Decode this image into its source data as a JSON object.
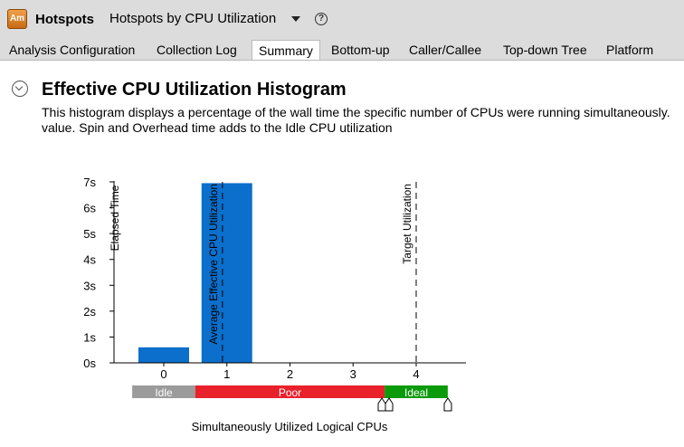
{
  "app": {
    "logo_text": "Am",
    "name": "Hotspots",
    "analysis_title": "Hotspots by CPU Utilization"
  },
  "tabs": [
    {
      "label": "Analysis Configuration"
    },
    {
      "label": "Collection Log"
    },
    {
      "label": "Summary",
      "active": true
    },
    {
      "label": "Bottom-up"
    },
    {
      "label": "Caller/Callee"
    },
    {
      "label": "Top-down Tree"
    },
    {
      "label": "Platform"
    }
  ],
  "section": {
    "title": "Effective CPU Utilization Histogram",
    "description_line1": "This histogram displays a percentage of the wall time the specific number of CPUs were running simultaneously.",
    "description_line2": "value.  Spin and Overhead time adds to the Idle CPU utilization"
  },
  "chart_data": {
    "type": "bar",
    "categories": [
      "0",
      "1",
      "2",
      "3",
      "4"
    ],
    "values": [
      0.6,
      6.95,
      0,
      0,
      0
    ],
    "y_ticks": [
      "0s",
      "1s",
      "2s",
      "3s",
      "4s",
      "5s",
      "6s",
      "7s"
    ],
    "ylim": [
      0,
      7
    ],
    "ylabel": "Elapsed Time",
    "xlabel": "Simultaneously Utilized Logical CPUs",
    "bar_color": "#0b6fcb",
    "markers": [
      {
        "label": "Average Effective CPU Utilization",
        "x": 0.93
      },
      {
        "label": "Target Utilization",
        "x": 4
      }
    ],
    "bands": [
      {
        "label": "Idle",
        "from": -0.5,
        "to": 0.5,
        "color": "#9b9b9b"
      },
      {
        "label": "Poor",
        "from": 0.5,
        "to": 3.5,
        "color": "#e8212b"
      },
      {
        "label": "Ideal",
        "from": 3.5,
        "to": 4.5,
        "color": "#0a9a0a"
      }
    ]
  },
  "icons": {
    "help": "help-icon",
    "collapse": "collapse-chevron-icon",
    "dropdown": "dropdown-arrow-icon",
    "slider_handle": "threshold-slider-handle-icon"
  }
}
